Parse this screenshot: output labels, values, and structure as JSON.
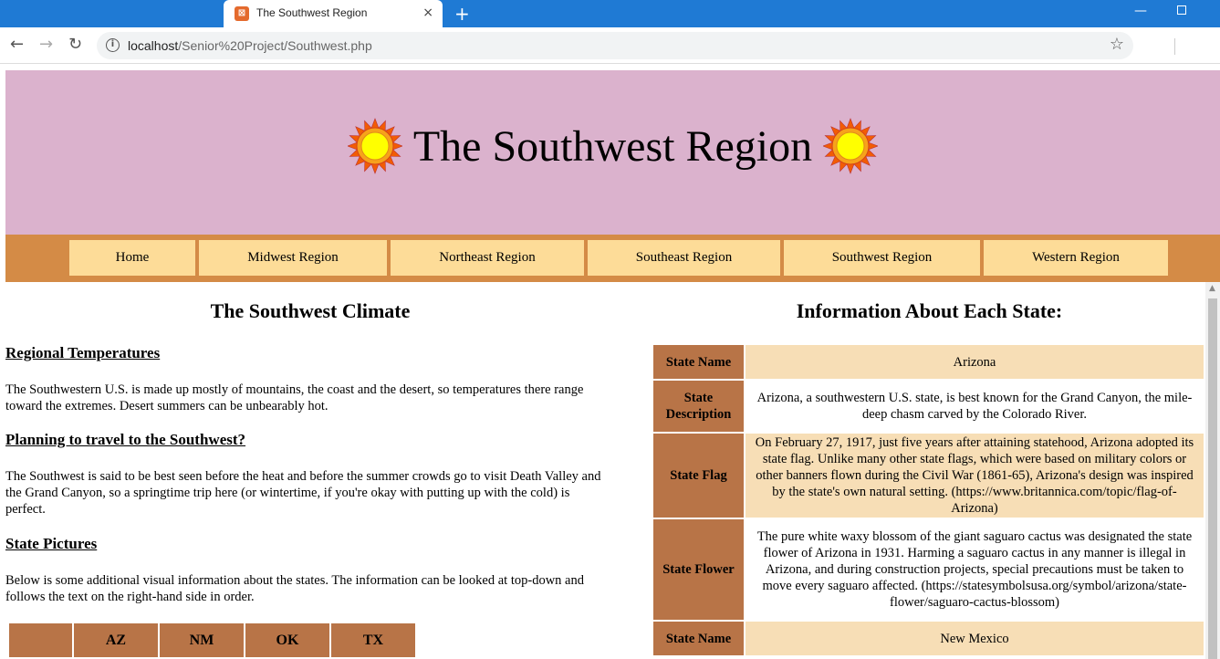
{
  "browser": {
    "tab_title": "The Southwest Region",
    "tab_close": "×",
    "new_tab": "+",
    "url_host": "localhost",
    "url_path": "/Senior%20Project/Southwest.php",
    "favicon_glyph": "⊠"
  },
  "banner": {
    "title": "The Southwest Region",
    "background": "#dbb2cd"
  },
  "nav": {
    "items": [
      "Home",
      "Midwest Region",
      "Northeast Region",
      "Southeast Region",
      "Southwest Region",
      "Western Region"
    ]
  },
  "left": {
    "heading": "The Southwest Climate",
    "sections": [
      {
        "heading": "Regional Temperatures",
        "text": "The Southwestern U.S. is made up mostly of mountains, the coast and the desert, so temperatures there range toward the extremes. Desert summers can be unbearably hot."
      },
      {
        "heading": "Planning to travel to the Southwest?",
        "text": "The Southwest is said to be best seen before the heat and before the summer crowds go to visit Death Valley and the Grand Canyon, so a springtime trip here (or wintertime, if you're okay with putting up with the cold) is perfect."
      },
      {
        "heading": "State Pictures",
        "text": "Below is some additional visual information about the states. The information can be looked at top-down and follows the text on the right-hand side in order."
      }
    ],
    "picture_table_headers": [
      "",
      "AZ",
      "NM",
      "OK",
      "TX"
    ]
  },
  "right": {
    "heading": "Information About Each State:",
    "rows": [
      {
        "label": "State Name",
        "value": "Arizona"
      },
      {
        "label": "State Description",
        "value": "Arizona, a southwestern U.S. state, is best known for the Grand Canyon, the mile-deep chasm carved by the Colorado River."
      },
      {
        "label": "State Flag",
        "value": "On February 27, 1917, just five years after attaining statehood, Arizona adopted its state flag. Unlike many other state flags, which were based on military colors or other banners flown during the Civil War (1861-65), Arizona's design was inspired by the state's own natural setting. (https://www.britannica.com/topic/flag-of-Arizona)"
      },
      {
        "label": "State Flower",
        "value": "The pure white waxy blossom of the giant saguaro cactus was designated the state flower of Arizona in 1931. Harming a saguaro cactus in any manner is illegal in Arizona, and during construction projects, special precautions must be taken to move every saguaro affected. (https://statesymbolsusa.org/symbol/arizona/state-flower/saguaro-cactus-blossom)"
      },
      {
        "label": "State Name",
        "value": "New Mexico"
      }
    ]
  },
  "colors": {
    "nav_bar": "#d48b46",
    "nav_item": "#fddc98",
    "label_cell": "#b87447",
    "alt_row": "#f7deb6"
  }
}
